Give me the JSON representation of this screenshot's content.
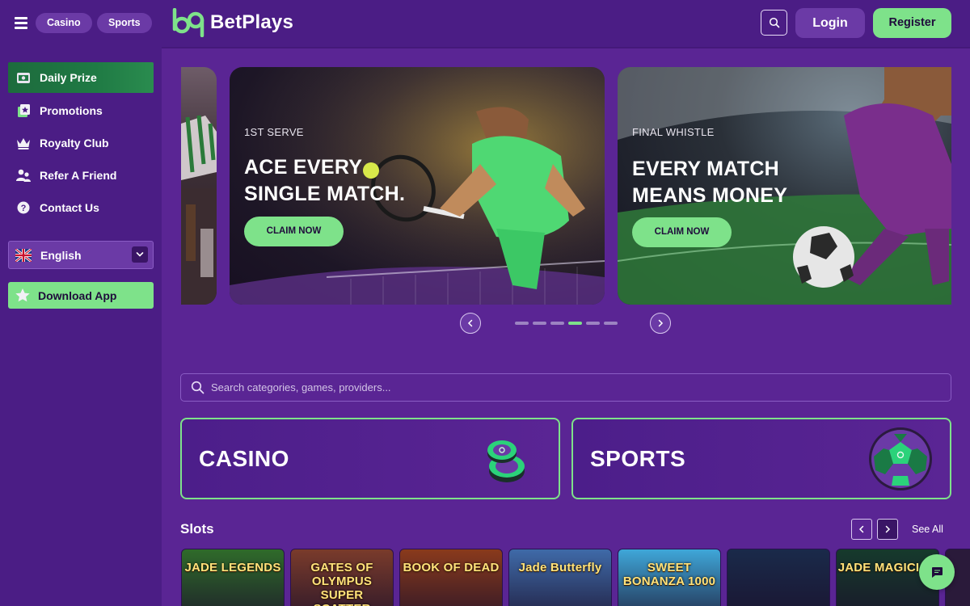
{
  "header": {
    "nav_pills": [
      "Casino",
      "Sports"
    ],
    "brand": "BetPlays",
    "login_label": "Login",
    "register_label": "Register"
  },
  "sidebar": {
    "items": [
      {
        "label": "Daily Prize",
        "icon": "gift-icon"
      },
      {
        "label": "Promotions",
        "icon": "star-card-icon"
      },
      {
        "label": "Royalty Club",
        "icon": "crown-icon"
      },
      {
        "label": "Refer A Friend",
        "icon": "users-icon"
      },
      {
        "label": "Contact Us",
        "icon": "question-icon"
      }
    ],
    "language": "English",
    "download_label": "Download App"
  },
  "banners": [
    {
      "kicker": "1ST SERVE",
      "headline_1": "ACE EVERY",
      "headline_2": "SINGLE MATCH.",
      "cta": "CLAIM NOW"
    },
    {
      "kicker": "FINAL WHISTLE",
      "headline_1": "EVERY MATCH",
      "headline_2": "MEANS MONEY",
      "cta": "CLAIM NOW"
    }
  ],
  "carousel": {
    "dot_count": 6,
    "active_index": 3
  },
  "search": {
    "placeholder": "Search categories, games, providers..."
  },
  "categories": [
    "CASINO",
    "SPORTS"
  ],
  "slots": {
    "title": "Slots",
    "see_all": "See All",
    "games": [
      {
        "name": "JADE LEGENDS",
        "bg": "#2f6b2a"
      },
      {
        "name": "GATES OF OLYMPUS SUPER SCATTER",
        "bg": "#7a3b2b"
      },
      {
        "name": "BOOK OF DEAD",
        "bg": "#8a3a1c"
      },
      {
        "name": "Jade Butterfly",
        "bg": "#3f6aa8"
      },
      {
        "name": "SWEET BONANZA 1000",
        "bg": "#3fa7d9"
      },
      {
        "name": "",
        "bg": "#1a2a4a"
      },
      {
        "name": "JADE MAGICIAN",
        "bg": "#163a2c"
      }
    ]
  },
  "colors": {
    "accent": "#7ee28a",
    "background": "#5a2594",
    "panel": "#4b1d85"
  }
}
